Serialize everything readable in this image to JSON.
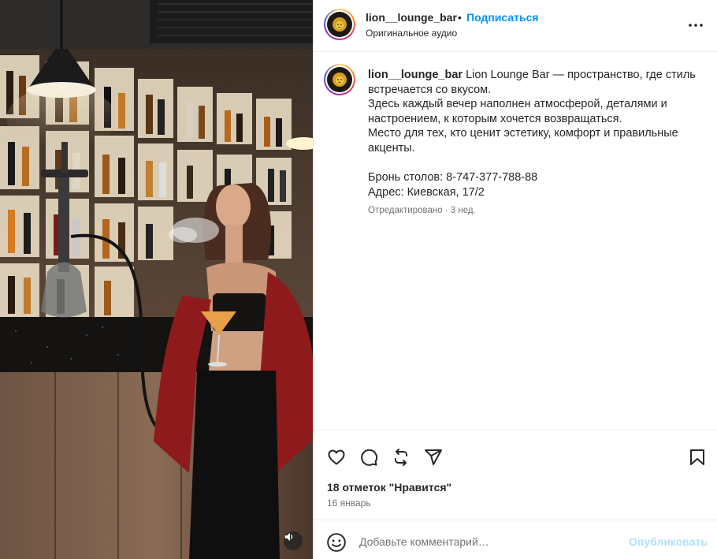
{
  "post": {
    "username": "lion__lounge_bar",
    "separator": "•",
    "follow_label": "Подписаться",
    "audio_label": "Оригинальное аудио",
    "more_icon": "more-horizontal-icon"
  },
  "caption": {
    "username": "lion__lounge_bar",
    "line1": "Lion Lounge Bar — пространство, где стиль встречается со вкусом.",
    "line2": "Здесь каждый вечер наполнен атмосферой, деталями и настроением, к которым хочется возвращаться.",
    "line3": "Место для тех, кто ценит эстетику, комфорт и правильные акценты.",
    "booking": "Бронь столов: 8-747-377-788-88",
    "address": "Адрес: Киевская, 17/2",
    "meta": "Отредактировано · 3 нед."
  },
  "actions": {
    "like_icon": "heart-icon",
    "comment_icon": "comment-icon",
    "repost_icon": "repost-icon",
    "share_icon": "send-icon",
    "save_icon": "bookmark-icon"
  },
  "likes_text": "18 отметок \"Нравится\"",
  "date_text": "16 январь",
  "comment": {
    "placeholder": "Добавьте комментарий…",
    "post_label": "Опубликовать"
  },
  "colors": {
    "accent": "#0095f6",
    "post_disabled": "#b2dffc",
    "jacket": "#8e1a1c"
  }
}
